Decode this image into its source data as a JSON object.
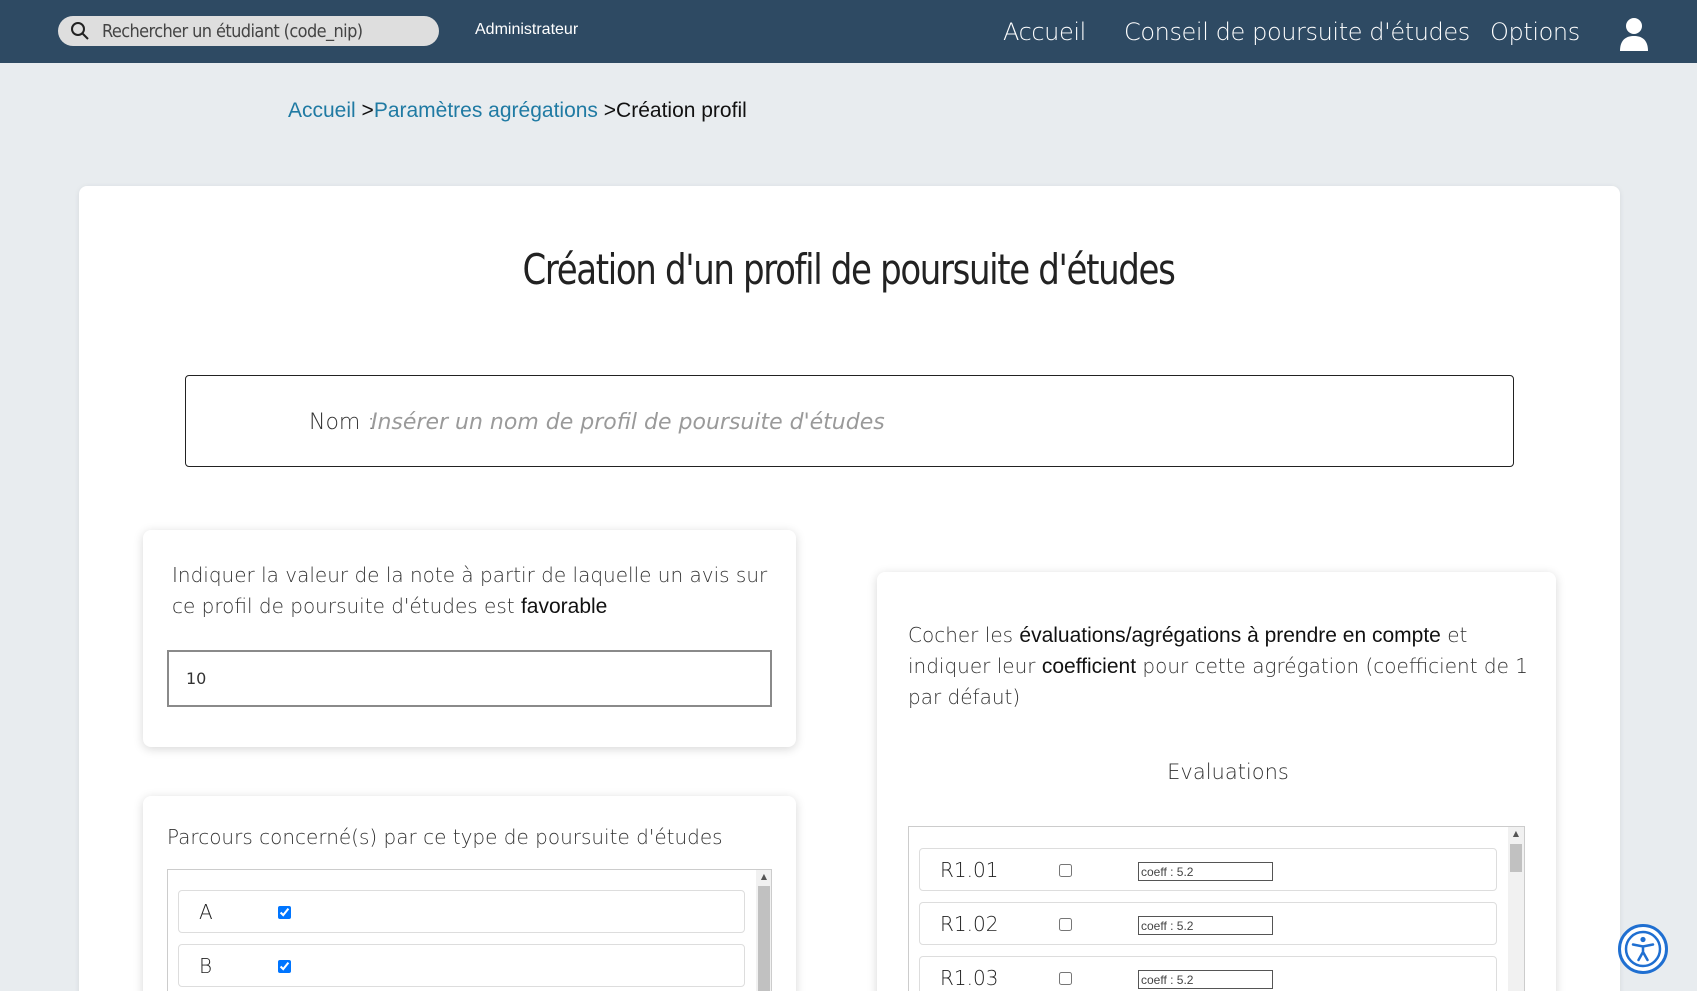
{
  "search": {
    "placeholder": "Rechercher un étudiant (code_nip)"
  },
  "header": {
    "role": "Administrateur",
    "nav": [
      {
        "label": "Accueil"
      },
      {
        "label": "Conseil de poursuite d'études"
      },
      {
        "label": "Options"
      }
    ]
  },
  "breadcrumb": {
    "home": "Accueil",
    "sep1": " >",
    "parent": "Paramètres agrégations",
    "sep2": " >",
    "current": "Création profil"
  },
  "page": {
    "title": "Création d'un profil de poursuite d'études"
  },
  "name_field": {
    "label": "Nom :",
    "placeholder": "Insérer un nom de profil de poursuite d'études",
    "value": ""
  },
  "threshold_panel": {
    "text_before": "Indiquer la valeur de la note à partir de laquelle un avis sur ce profil de poursuite d'études est ",
    "text_bold": "favorable",
    "value": "10"
  },
  "parcours_panel": {
    "title": "Parcours concerné(s) par ce type de poursuite d'études",
    "items": [
      {
        "label": "A",
        "checked": true
      },
      {
        "label": "B",
        "checked": true
      }
    ]
  },
  "evaluations_panel": {
    "text_1": "Cocher les ",
    "bold_1": "évaluations/agrégations à prendre en compte",
    "text_2": " et indiquer leur ",
    "bold_2": "coefficient",
    "text_3": " pour cette agrégation (coefficient de 1 par défaut)",
    "list_title": "Evaluations",
    "items": [
      {
        "label": "R1.01",
        "checked": false,
        "coeff_placeholder": "coeff : 5.2"
      },
      {
        "label": "R1.02",
        "checked": false,
        "coeff_placeholder": "coeff : 5.2"
      },
      {
        "label": "R1.03",
        "checked": false,
        "coeff_placeholder": "coeff : 5.2"
      }
    ]
  },
  "icons": {
    "search": "search-icon",
    "user": "user-icon",
    "accessibility": "accessibility-icon"
  },
  "colors": {
    "topbar": "#2e4a63",
    "link": "#1f7aa3",
    "background": "#e8ecef",
    "accessibility": "#1f6fd1"
  }
}
